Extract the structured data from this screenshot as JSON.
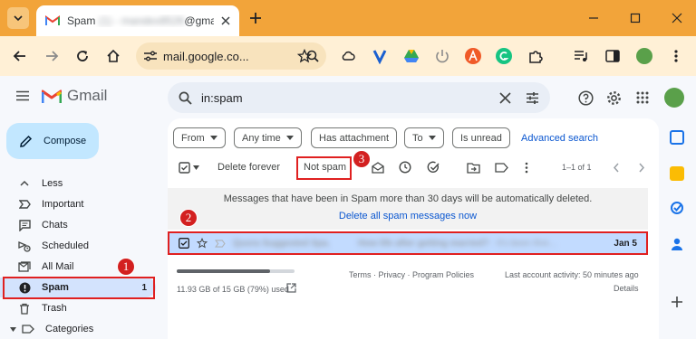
{
  "browser": {
    "tab_title": "Spam",
    "tab_title_obscured": "(1) - mandex8526",
    "tab_title_suffix": "@gmail",
    "url": "mail.google.co..."
  },
  "gmail": {
    "logo_text": "Gmail",
    "search_value": "in:spam",
    "compose_label": "Compose",
    "nav": [
      {
        "label": "Less",
        "icon": "chevron-up-icon"
      },
      {
        "label": "Important",
        "icon": "important-icon"
      },
      {
        "label": "Chats",
        "icon": "chat-icon"
      },
      {
        "label": "Scheduled",
        "icon": "scheduled-icon"
      },
      {
        "label": "All Mail",
        "icon": "all-mail-icon"
      },
      {
        "label": "Spam",
        "icon": "spam-icon",
        "count": "1",
        "selected": true
      },
      {
        "label": "Trash",
        "icon": "trash-icon"
      },
      {
        "label": "Categories",
        "icon": "label-icon"
      }
    ],
    "filters": [
      "From",
      "Any time",
      "Has attachment",
      "To",
      "Is unread"
    ],
    "advanced_search": "Advanced search",
    "actions": {
      "delete_forever": "Delete forever",
      "not_spam": "Not spam",
      "pagination": "1–1 of 1"
    },
    "banner": {
      "message": "Messages that have been in Spam more than 30 days will be automatically deleted.",
      "link": "Delete all spam messages now"
    },
    "email": {
      "sender": "Quora Suggested Spa.",
      "subject": "How life after getting married?",
      "snippet": " - It's been thre...",
      "date": "Jan 5"
    },
    "storage": {
      "text": "11.93 GB of 15 GB (79%) used",
      "percent": 79
    },
    "footer": {
      "links": "Terms · Privacy · Program Policies",
      "activity": "Last account activity: 50 minutes ago",
      "details": "Details"
    }
  },
  "annotations": [
    "1",
    "2",
    "3"
  ],
  "colors": {
    "browser_frame": "#f2a43a",
    "toolbar": "#fff0d6",
    "selected_nav": "#d3e3fd",
    "selected_row": "#c2dbff",
    "annotation_red": "#e02020",
    "link_blue": "#0b57d0"
  }
}
